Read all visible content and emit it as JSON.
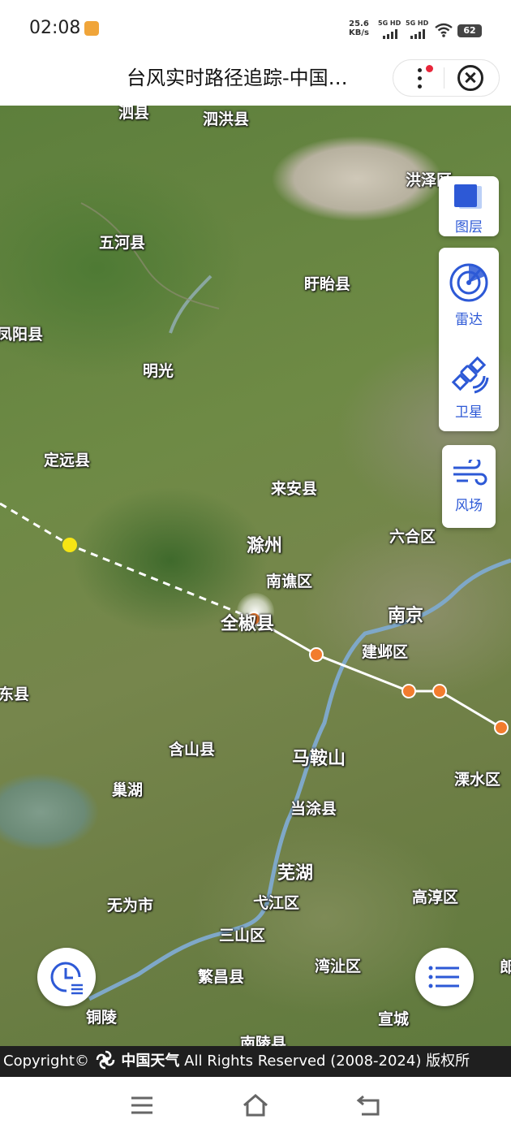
{
  "status": {
    "time": "02:08",
    "net_speed_value": "25.6",
    "net_speed_unit": "KB/s",
    "sim1": "5G HD",
    "sim2": "5G HD",
    "battery": "62"
  },
  "header": {
    "title": "台风实时路径追踪-中国…"
  },
  "map": {
    "places": {
      "sixian": "泗县",
      "sihong": "泗洪县",
      "hongze": "洪泽区",
      "wuhe": "五河县",
      "xuyi": "盱眙县",
      "fengyang": "凤阳县",
      "mingguang": "明光",
      "dingyuan": "定远县",
      "laian": "来安县",
      "chuzhou": "滁州",
      "nanqiao": "南谯区",
      "quanjiao": "全椒县",
      "liuhe": "六合区",
      "nanjing": "南京",
      "jianye": "建邺区",
      "dongxian": "东县",
      "hanshan": "含山县",
      "maanshan": "马鞍山",
      "lishui": "溧水区",
      "chaohu": "巢湖",
      "dangtu": "当涂县",
      "wuhu": "芜湖",
      "gaochun": "高淳区",
      "wuwei": "无为市",
      "yijiang": "弋江区",
      "sanshan": "三山区",
      "wanzhi": "湾沚区",
      "fanchang": "繁昌县",
      "tongling": "铜陵",
      "xuancheng": "宣城",
      "nanling": "南陵县",
      "lang": "郎"
    },
    "track_colors": {
      "forecast_line": "#ffffff",
      "history_line": "#ffffff",
      "past_point": "#f27c2e",
      "forecast_point": "#f6e514"
    }
  },
  "tools": {
    "layers": "图层",
    "radar": "雷达",
    "satellite": "卫星",
    "wind": "风场"
  },
  "icons": {
    "history": "clock-list-icon",
    "list": "list-icon"
  },
  "footer": {
    "prefix": "Copyright©",
    "brand": "中国天气",
    "rights": "All Rights Reserved (2008-2024) 版权所"
  },
  "nav": {
    "menu": "menu-icon",
    "home": "home-icon",
    "back": "back-icon"
  }
}
